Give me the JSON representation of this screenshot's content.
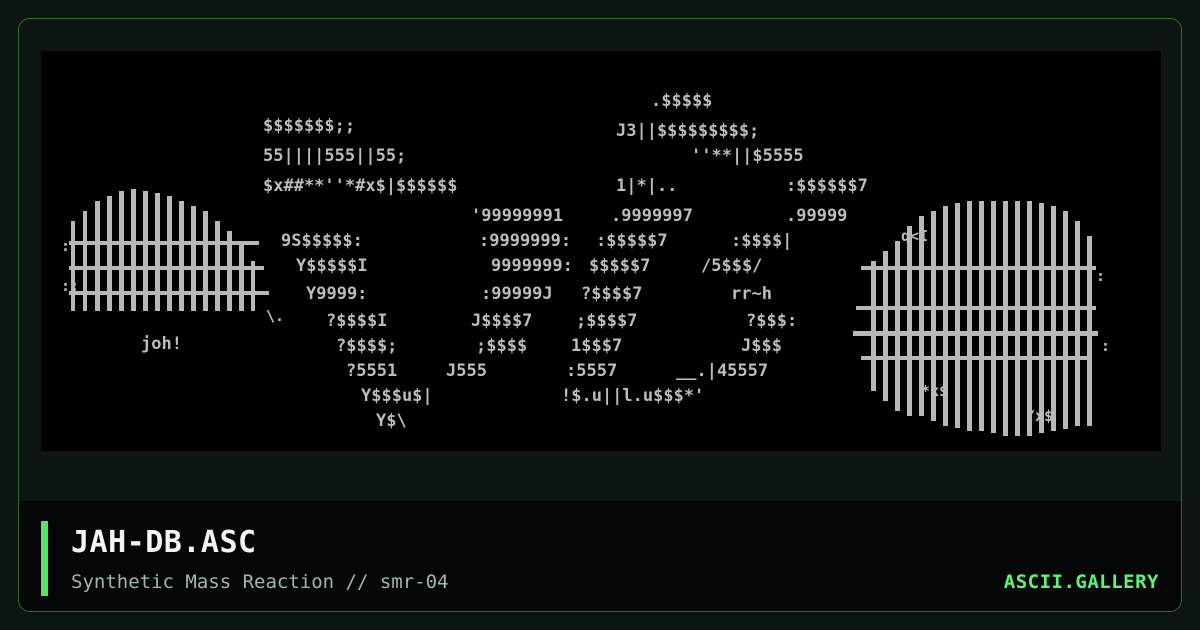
{
  "card": {
    "title": "JAH-DB.ASC",
    "subtitle": "Synthetic Mass Reaction // smr-04",
    "brand": "ASCII.GALLERY"
  },
  "colors": {
    "accent": "#56e36a",
    "brand": "#5ef27a",
    "background": "#0a1512",
    "art_background": "#000000",
    "art_glyphs": "#bdbdbd"
  },
  "art": {
    "signature": "joh!"
  }
}
